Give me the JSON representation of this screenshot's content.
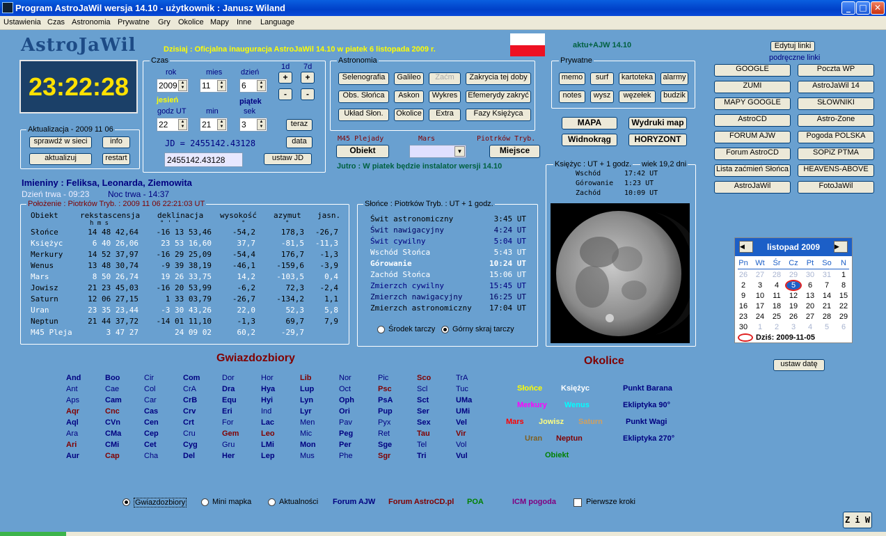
{
  "window": {
    "title": "Program AstroJaWil wersja 14.10 - użytkownik : Janusz Wiland",
    "min": "_",
    "max": "□",
    "close": "✕"
  },
  "menu": [
    "Ustawienia",
    "Czas",
    "Astronomia",
    "Prywatne",
    "Gry",
    "Okolice",
    "Mapy",
    "Inne",
    "Language"
  ],
  "logo": "AstroJaWil",
  "clock": "23:22:28",
  "today": "Dzisiaj : Oficjalna inauguracja AstroJaWil 14.10 w piatek 6 listopada 2009 r.",
  "aktu": "aktu+AJW 14.10",
  "flag": {
    "top": "#ffffff",
    "bottom": "#ee1122"
  },
  "update": {
    "title": "Aktualizacja - 2009 11 06",
    "check": "sprawdź w sieci",
    "info": "info",
    "update": "aktualizuj",
    "restart": "restart"
  },
  "czas": {
    "title": "Czas",
    "rok": "rok",
    "mies": "mies",
    "dzien": "dzień",
    "d1": "1d",
    "d7": "7d",
    "year": "2009",
    "month": "11",
    "day": "6",
    "plus": "+",
    "minus": "-",
    "season": "jesień",
    "weekday": "piątek",
    "godz": "godz UT",
    "min": "min",
    "sek": "sek",
    "hour": "22",
    "minute": "21",
    "second": "3",
    "teraz": "teraz",
    "jd_label": "JD = 2455142.43128",
    "data": "data",
    "jd_value": "2455142.43128",
    "ustaw_jd": "ustaw JD"
  },
  "astronomia": {
    "title": "Astronomia",
    "buttons": [
      "Selenografia",
      "Galileo",
      "Zaćm",
      "Zakrycia tej doby",
      "Obs. Słońca",
      "Askon",
      "Wykres",
      "Efemerydy zakryć",
      "Układ Słon.",
      "Okolice",
      "Extra",
      "Fazy Księżyca"
    ]
  },
  "prywatne": {
    "title": "Prywatne",
    "buttons": [
      "memo",
      "surf",
      "kartoteka",
      "alarmy",
      "notes",
      "wysz",
      "węzełek",
      "budzik"
    ]
  },
  "maps": {
    "mapa": "MAPA",
    "wydruki": "Wydruki map",
    "widnokrag": "Widnokrąg",
    "horyzont": "HORYZONT"
  },
  "objects": {
    "m45": "M45 Plejady",
    "mars": "Mars",
    "place": "Piotrków Tryb.",
    "obiekt": "Obiekt",
    "miejsce": "Miejsce",
    "jutro": "Jutro : W piatek będzie instalator wersji 14.10"
  },
  "links": {
    "edit": "Edytuj linki",
    "subtitle": "podręczne linki",
    "left": [
      "GOOGLE",
      "ZUMI",
      "MAPY GOOGLE",
      "AstroCD",
      "FORUM AJW",
      "Forum AstroCD",
      "Lista zaćmień Słońca",
      "AstroJaWil"
    ],
    "right": [
      "Poczta WP",
      "AstroJaWil 14",
      "SŁOWNIKI",
      "Astro-Zone",
      "Pogoda POLSKA",
      "SOPiZ PTMA",
      "HEAVENS-ABOVE",
      "FotoJaWil"
    ]
  },
  "names": {
    "imieniny": "Imieniny : Feliksa, Leonarda, Ziemowita",
    "day": "Dzień trwa - 09:23",
    "night": "Noc trwa - 14:37"
  },
  "positions": {
    "title": "Położenie : Piotrków Tryb. : 2009 11 06   22:21:03 UT",
    "headers": [
      "Obiekt",
      "rekstascensja",
      "deklinacja",
      "wysokość",
      "azymut",
      "jasn."
    ],
    "units_ra": "h   m   s",
    "units_dec": "°   '   \"",
    "units_alt": "°",
    "units_az": "°",
    "rows": [
      {
        "name": "Słońce",
        "ra": "14 48 42,64",
        "dec": "-16 13 53,46",
        "alt": "-54,2",
        "az": "178,3",
        "mag": "-26,7",
        "color": "#000000"
      },
      {
        "name": "Księżyc",
        "ra": "6 40 26,06",
        "dec": "23 53 16,60",
        "alt": "37,7",
        "az": "-81,5",
        "mag": "-11,3",
        "color": "#ffffff"
      },
      {
        "name": "Merkury",
        "ra": "14 52 37,97",
        "dec": "-16 29 25,09",
        "alt": "-54,4",
        "az": "176,7",
        "mag": "-1,3",
        "color": "#000000"
      },
      {
        "name": "Wenus",
        "ra": "13 48 30,74",
        "dec": "-9 39 38,19",
        "alt": "-46,1",
        "az": "-159,6",
        "mag": "-3,9",
        "color": "#000000"
      },
      {
        "name": "Mars",
        "ra": "8 50 26,74",
        "dec": "19 26 33,75",
        "alt": "14,2",
        "az": "-103,5",
        "mag": "0,4",
        "color": "#ffffff"
      },
      {
        "name": "Jowisz",
        "ra": "21 23 45,03",
        "dec": "-16 20 53,99",
        "alt": "-6,2",
        "az": "72,3",
        "mag": "-2,4",
        "color": "#000000"
      },
      {
        "name": "Saturn",
        "ra": "12 06 27,15",
        "dec": "1 33 03,79",
        "alt": "-26,7",
        "az": "-134,2",
        "mag": "1,1",
        "color": "#000000"
      },
      {
        "name": "Uran",
        "ra": "23 35 23,44",
        "dec": "-3 30 43,26",
        "alt": "22,0",
        "az": "52,3",
        "mag": "5,8",
        "color": "#ffffff"
      },
      {
        "name": "Neptun",
        "ra": "21 44 37,72",
        "dec": "-14 01 11,10",
        "alt": "-1,3",
        "az": "69,7",
        "mag": "7,9",
        "color": "#000000"
      },
      {
        "name": "M45 Pleja",
        "ra": "3 47 27",
        "dec": "24 09 02",
        "alt": "60,2",
        "az": "-29,7",
        "mag": "",
        "color": "#ffffff"
      }
    ]
  },
  "sun": {
    "title": "Słońce : Piotrków Tryb. : UT + 1 godz.",
    "rows": [
      {
        "l": "Świt astronomiczny",
        "t": "3:45 UT",
        "c": "#000000"
      },
      {
        "l": "Świt nawigacyjny",
        "t": "4:24 UT",
        "c": "#000060"
      },
      {
        "l": "Świt cywilny",
        "t": "5:04 UT",
        "c": "#000080"
      },
      {
        "l": "Wschód Słońca",
        "t": "5:43 UT",
        "c": "#ffffff"
      },
      {
        "l": "Górowanie",
        "t": "10:24 UT",
        "c": "#ffffff"
      },
      {
        "l": "Zachód Słońca",
        "t": "15:06 UT",
        "c": "#ffffff"
      },
      {
        "l": "Zmierzch cywilny",
        "t": "15:45 UT",
        "c": "#000080"
      },
      {
        "l": "Zmierzch nawigacyjny",
        "t": "16:25 UT",
        "c": "#000060"
      },
      {
        "l": "Zmierzch astronomiczny",
        "t": "17:04 UT",
        "c": "#000000"
      }
    ],
    "opt1": "Środek tarczy",
    "opt2": "Górny skraj tarczy"
  },
  "moon": {
    "title": "Księżyc :  UT + 1 godz.",
    "age": "wiek 19,2 dni",
    "rows": [
      {
        "l": "Wschód",
        "t": "17:42 UT"
      },
      {
        "l": "Górowanie",
        "t": "1:23 UT"
      },
      {
        "l": "Zachód",
        "t": "10:09 UT"
      }
    ]
  },
  "calendar": {
    "month": "listopad 2009",
    "prev": "◀",
    "next": "▶",
    "days": [
      "Pn",
      "Wt",
      "Śr",
      "Cz",
      "Pt",
      "So",
      "N"
    ],
    "cells": [
      [
        "26",
        "27",
        "28",
        "29",
        "30",
        "31",
        "1"
      ],
      [
        "2",
        "3",
        "4",
        "5",
        "6",
        "7",
        "8"
      ],
      [
        "9",
        "10",
        "11",
        "12",
        "13",
        "14",
        "15"
      ],
      [
        "16",
        "17",
        "18",
        "19",
        "20",
        "21",
        "22"
      ],
      [
        "23",
        "24",
        "25",
        "26",
        "27",
        "28",
        "29"
      ],
      [
        "30",
        "1",
        "2",
        "3",
        "4",
        "5",
        "6"
      ]
    ],
    "today": "Dziś: 2009-11-05",
    "set": "ustaw datę"
  },
  "constellations": {
    "title": "Gwiazdozbiory",
    "columns": [
      [
        [
          "And",
          "#000080"
        ],
        [
          "Ant",
          "#000080"
        ],
        [
          "Aps",
          "#000080"
        ],
        [
          "Aqr",
          "#800000"
        ],
        [
          "Aql",
          "#000080"
        ],
        [
          "Ara",
          "#000080"
        ],
        [
          "Ari",
          "#800000"
        ],
        [
          "Aur",
          "#000080"
        ]
      ],
      [
        [
          "Boo",
          "#000080"
        ],
        [
          "Cae",
          "#000080"
        ],
        [
          "Cam",
          "#000080"
        ],
        [
          "Cnc",
          "#800000"
        ],
        [
          "CVn",
          "#000080"
        ],
        [
          "CMa",
          "#000080"
        ],
        [
          "CMi",
          "#000080"
        ],
        [
          "Cap",
          "#800000"
        ]
      ],
      [
        [
          "Cir",
          "#000080"
        ],
        [
          "Col",
          "#000080"
        ],
        [
          "Car",
          "#000080"
        ],
        [
          "Cas",
          "#000080"
        ],
        [
          "Cen",
          "#000080"
        ],
        [
          "Cep",
          "#000080"
        ],
        [
          "Cet",
          "#000080"
        ],
        [
          "Cha",
          "#000080"
        ]
      ],
      [
        [
          "Com",
          "#000080"
        ],
        [
          "CrA",
          "#000080"
        ],
        [
          "CrB",
          "#000080"
        ],
        [
          "Crv",
          "#000080"
        ],
        [
          "Crt",
          "#000080"
        ],
        [
          "Cru",
          "#000080"
        ],
        [
          "Cyg",
          "#000080"
        ],
        [
          "Del",
          "#000080"
        ]
      ],
      [
        [
          "Dor",
          "#000080"
        ],
        [
          "Dra",
          "#000080"
        ],
        [
          "Equ",
          "#000080"
        ],
        [
          "Eri",
          "#000080"
        ],
        [
          "For",
          "#000080"
        ],
        [
          "Gem",
          "#800000"
        ],
        [
          "Gru",
          "#000080"
        ],
        [
          "Her",
          "#000080"
        ]
      ],
      [
        [
          "Hor",
          "#000080"
        ],
        [
          "Hya",
          "#000080"
        ],
        [
          "Hyi",
          "#000080"
        ],
        [
          "Ind",
          "#000080"
        ],
        [
          "Lac",
          "#000080"
        ],
        [
          "Leo",
          "#800000"
        ],
        [
          "LMi",
          "#000080"
        ],
        [
          "Lep",
          "#000080"
        ]
      ],
      [
        [
          "Lib",
          "#800000"
        ],
        [
          "Lup",
          "#000080"
        ],
        [
          "Lyn",
          "#000080"
        ],
        [
          "Lyr",
          "#000080"
        ],
        [
          "Men",
          "#000080"
        ],
        [
          "Mic",
          "#000080"
        ],
        [
          "Mon",
          "#000080"
        ],
        [
          "Mus",
          "#000080"
        ]
      ],
      [
        [
          "Nor",
          "#000080"
        ],
        [
          "Oct",
          "#000080"
        ],
        [
          "Oph",
          "#000080"
        ],
        [
          "Ori",
          "#000080"
        ],
        [
          "Pav",
          "#000080"
        ],
        [
          "Peg",
          "#000080"
        ],
        [
          "Per",
          "#000080"
        ],
        [
          "Phe",
          "#000080"
        ]
      ],
      [
        [
          "Pic",
          "#000080"
        ],
        [
          "Psc",
          "#800000"
        ],
        [
          "PsA",
          "#000080"
        ],
        [
          "Pup",
          "#000080"
        ],
        [
          "Pyx",
          "#000080"
        ],
        [
          "Ret",
          "#000080"
        ],
        [
          "Sge",
          "#000080"
        ],
        [
          "Sgr",
          "#800000"
        ]
      ],
      [
        [
          "Sco",
          "#800000"
        ],
        [
          "Scl",
          "#000080"
        ],
        [
          "Sct",
          "#000080"
        ],
        [
          "Ser",
          "#000080"
        ],
        [
          "Sex",
          "#000080"
        ],
        [
          "Tau",
          "#800000"
        ],
        [
          "Tel",
          "#000080"
        ],
        [
          "Tri",
          "#000080"
        ]
      ],
      [
        [
          "TrA",
          "#000080"
        ],
        [
          "Tuc",
          "#000080"
        ],
        [
          "UMa",
          "#000080"
        ],
        [
          "UMi",
          "#000080"
        ],
        [
          "Vel",
          "#000080"
        ],
        [
          "Vir",
          "#800000"
        ],
        [
          "Vol",
          "#000080"
        ],
        [
          "Vul",
          "#000080"
        ]
      ]
    ]
  },
  "okolice": {
    "title": "Okolice",
    "items": [
      {
        "t": "Słońce",
        "c": "#ffff00"
      },
      {
        "t": "Księżyc",
        "c": "#ffffff"
      },
      {
        "t": "Punkt Barana",
        "c": "#000080"
      },
      {
        "t": "Merkury",
        "c": "#ff00ff"
      },
      {
        "t": "Wenus",
        "c": "#00ffff"
      },
      {
        "t": "Ekliptyka 90°",
        "c": "#000080"
      },
      {
        "t": "Mars",
        "c": "#ff0000"
      },
      {
        "t": "Jowisz",
        "c": "#ffff80"
      },
      {
        "t": "Saturn",
        "c": "#d0a060"
      },
      {
        "t": "Punkt Wagi",
        "c": "#000080"
      },
      {
        "t": "Uran",
        "c": "#806020"
      },
      {
        "t": "Neptun",
        "c": "#800000"
      },
      {
        "t": "Ekliptyka 270°",
        "c": "#000080"
      },
      {
        "t": "Obiekt",
        "c": "#008000"
      }
    ]
  },
  "bottom": {
    "r1": "Gwiazdozbiory",
    "r2": "Mini mapka",
    "r3": "Aktualności",
    "forum": "Forum AJW",
    "forumcd": "Forum AstroCD.pl",
    "poa": "POA",
    "icm": "ICM pogoda",
    "first": "Pierwsze kroki",
    "ziw": "Z i W"
  }
}
